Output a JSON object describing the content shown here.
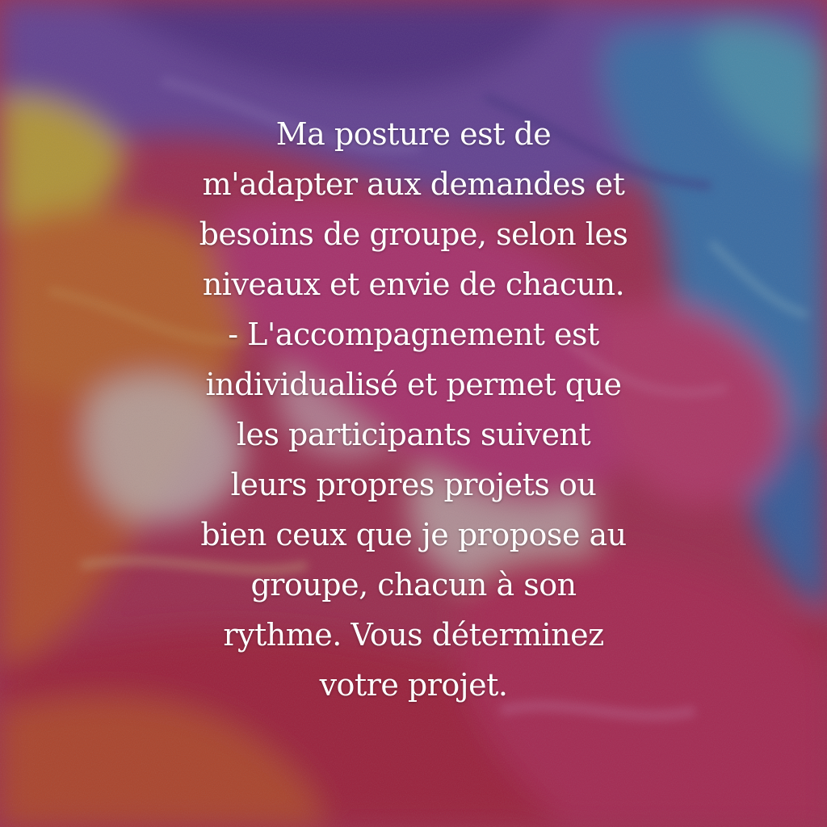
{
  "background": {
    "description_icon": "abstract-paint-icon",
    "colors": {
      "purple": "#7a55b8",
      "blue": "#3f8fd0",
      "teal": "#56b8d6",
      "orange": "#e8792a",
      "yellow": "#e7c83a",
      "magenta": "#d93d82",
      "red": "#c9283f",
      "cream": "#efe2d6"
    }
  },
  "quote": {
    "lines": [
      "Ma posture est de",
      "m'adapter aux demandes et",
      "besoins de groupe, selon les",
      "niveaux et envie de chacun.",
      "- L'accompagnement est",
      "individualisé et permet que",
      "les participants suivent",
      "leurs propres projets ou",
      "bien ceux que je propose au",
      "groupe, chacun à son",
      "rythme. Vous déterminez",
      "votre projet."
    ]
  }
}
